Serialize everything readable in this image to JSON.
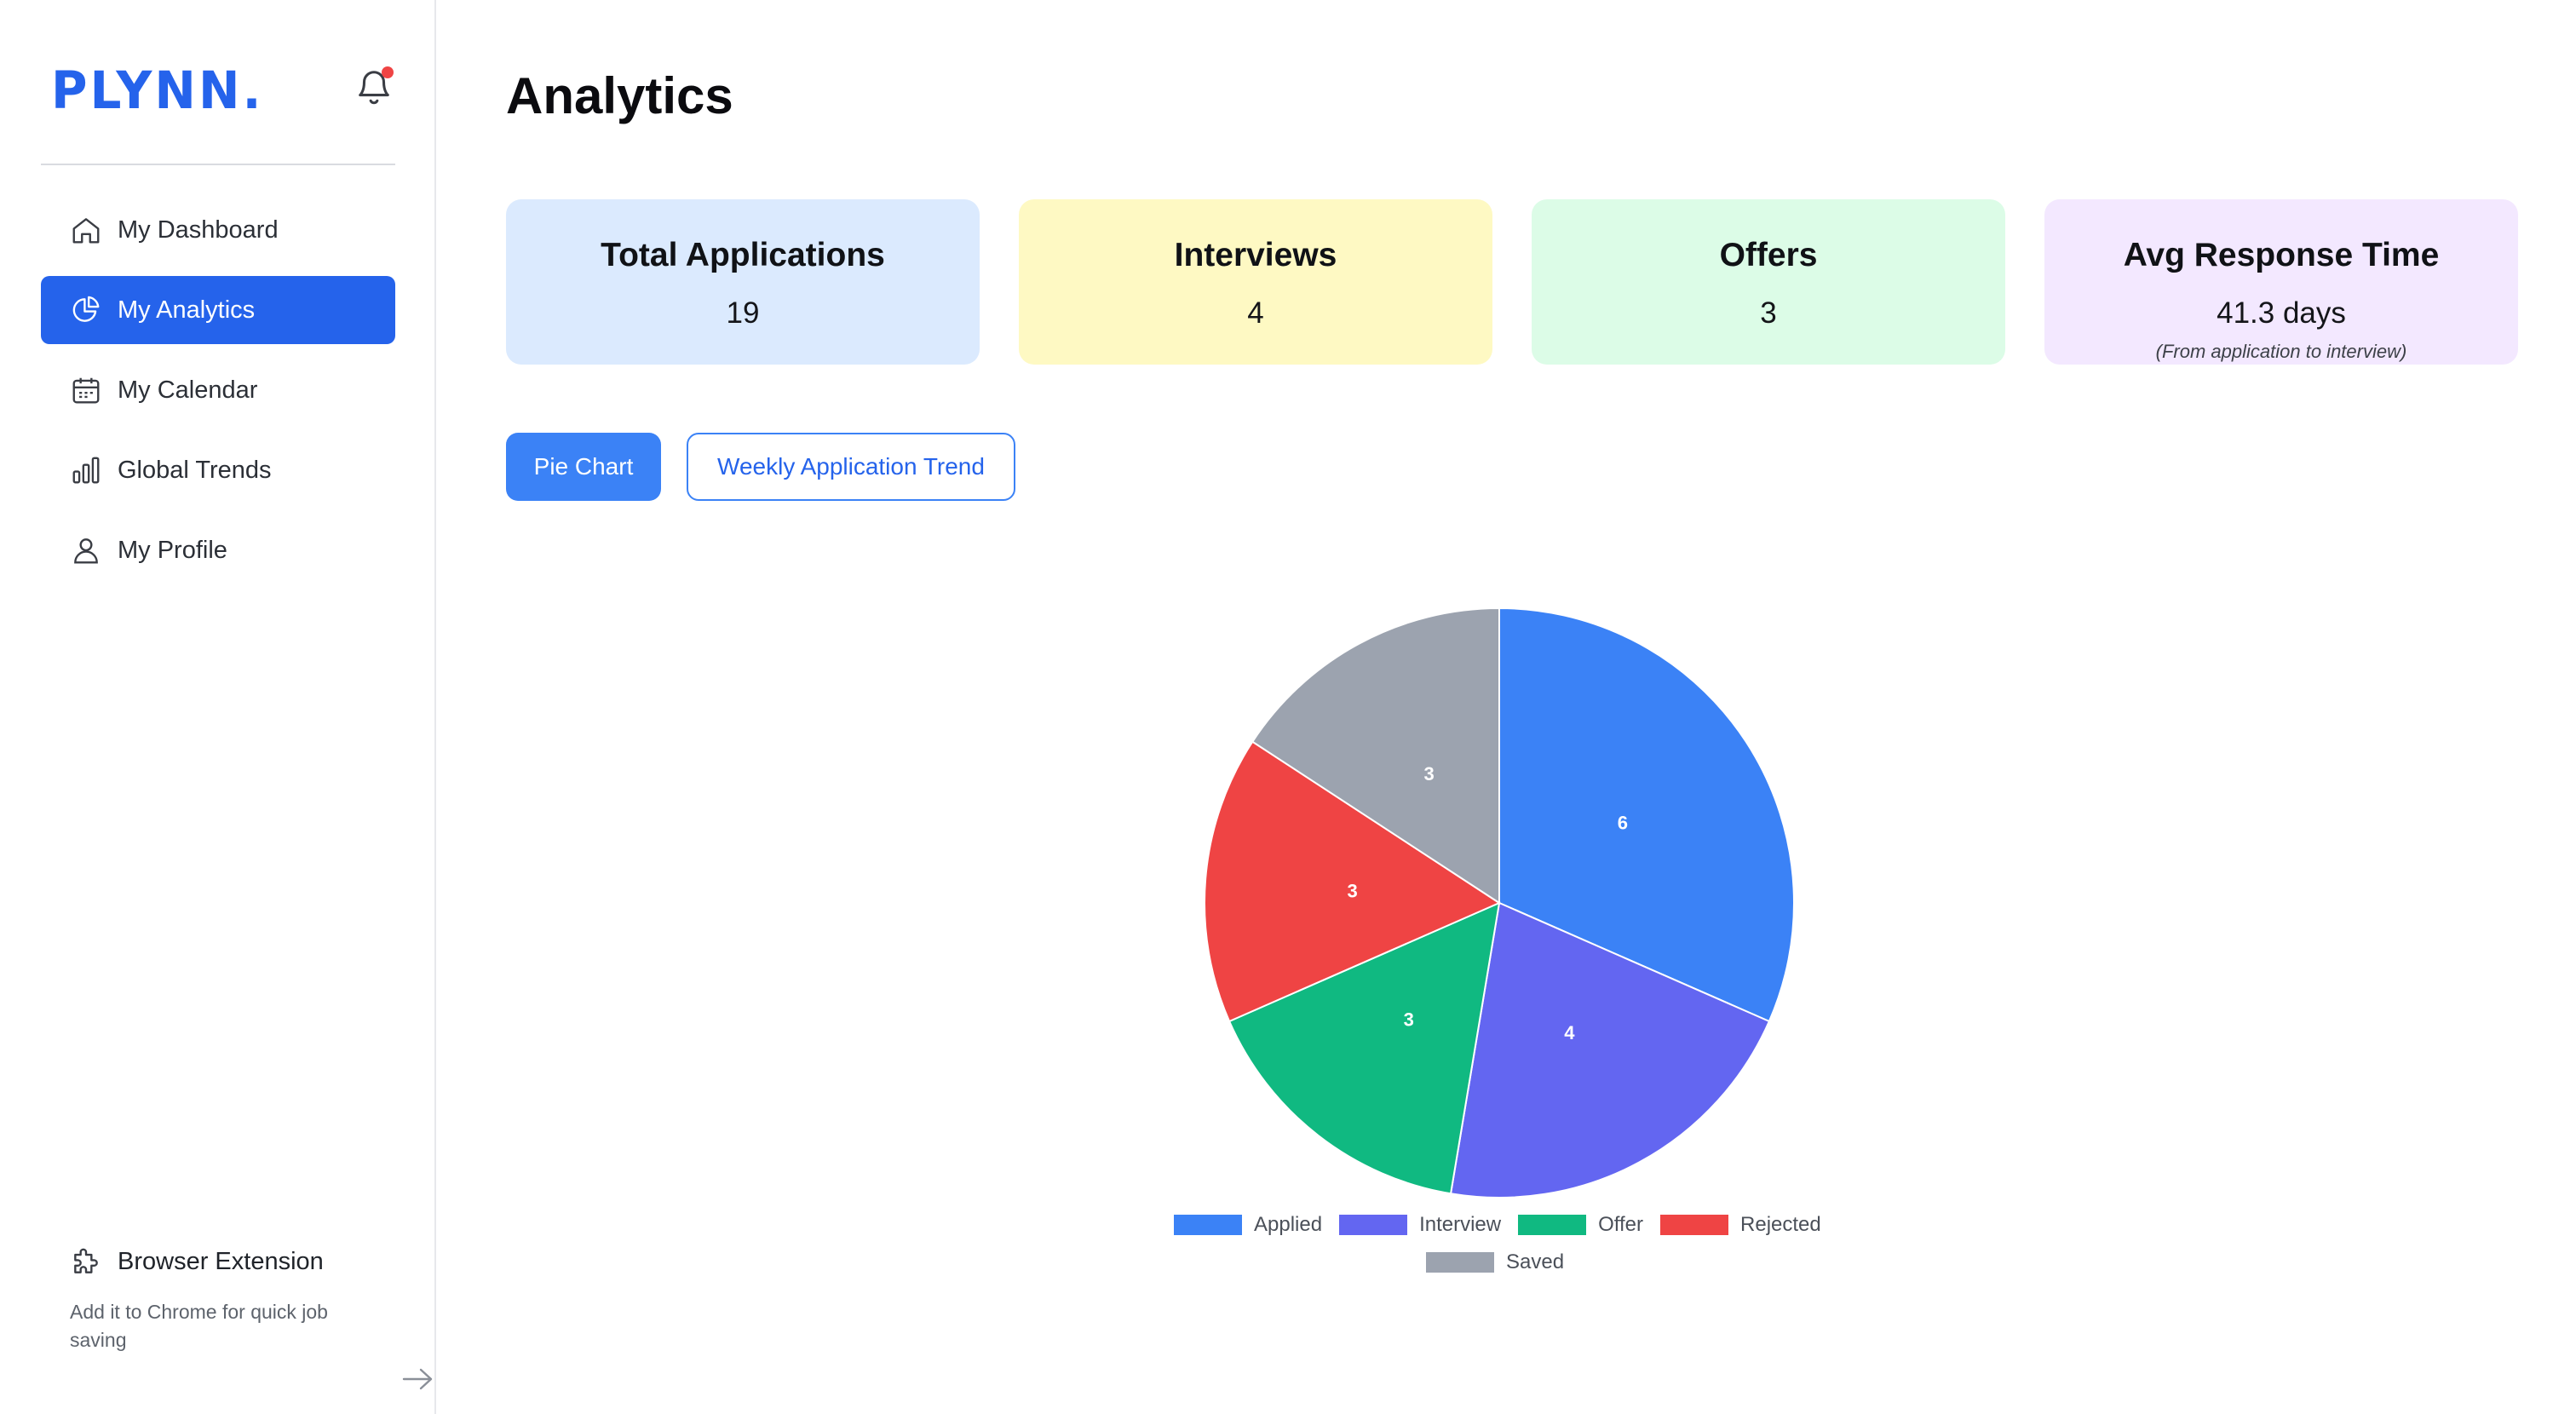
{
  "brand": {
    "logo": "PLYNN."
  },
  "sidebar": {
    "items": [
      {
        "label": "My Dashboard",
        "icon": "home-icon"
      },
      {
        "label": "My Analytics",
        "icon": "pie-chart-icon",
        "active": true
      },
      {
        "label": "My Calendar",
        "icon": "calendar-icon"
      },
      {
        "label": "Global Trends",
        "icon": "bar-chart-icon"
      },
      {
        "label": "My Profile",
        "icon": "user-icon"
      }
    ],
    "extension": {
      "title": "Browser Extension",
      "description": "Add it to Chrome for quick job saving"
    }
  },
  "page": {
    "title": "Analytics"
  },
  "stats": [
    {
      "label": "Total Applications",
      "value": "19",
      "color": "#dbeafe"
    },
    {
      "label": "Interviews",
      "value": "4",
      "color": "#fef9c3"
    },
    {
      "label": "Offers",
      "value": "3",
      "color": "#dcfce7"
    },
    {
      "label": "Avg Response Time",
      "value": "41.3 days",
      "note": "(From application to interview)",
      "color": "#f3e8ff"
    }
  ],
  "tabs": {
    "pie": "Pie Chart",
    "weekly": "Weekly Application Trend"
  },
  "chart_data": {
    "type": "pie",
    "categories": [
      "Applied",
      "Interview",
      "Offer",
      "Rejected",
      "Saved"
    ],
    "values": [
      6,
      4,
      3,
      3,
      3
    ],
    "colors": [
      "#3b82f6",
      "#6366f1",
      "#10b981",
      "#ef4444",
      "#9ca3af"
    ],
    "legend": "bottom"
  }
}
